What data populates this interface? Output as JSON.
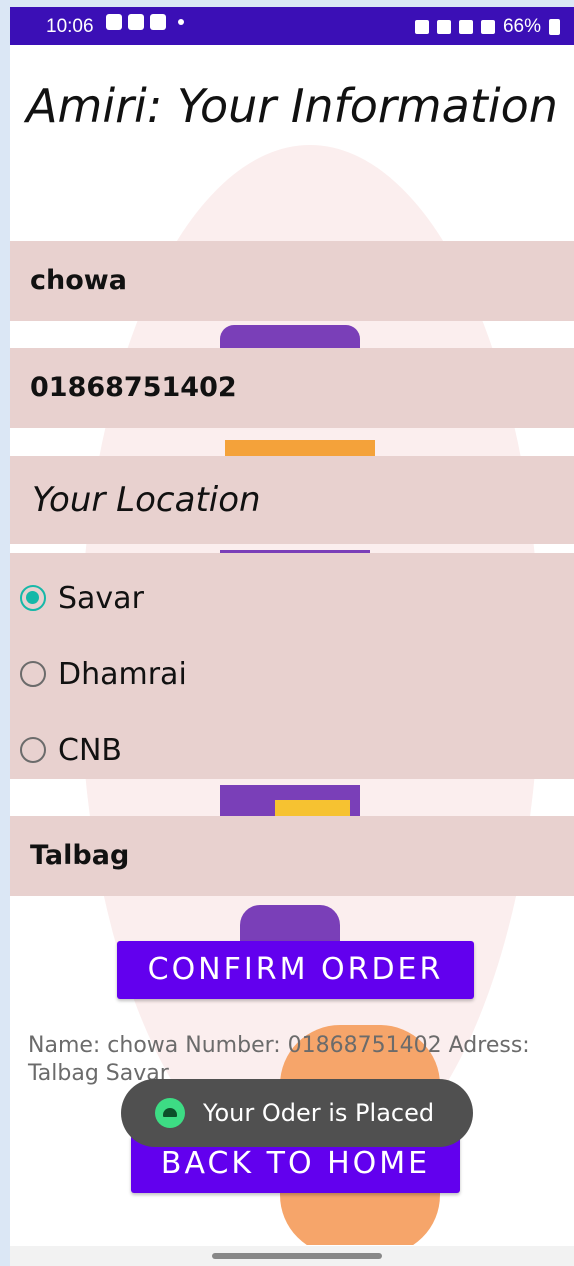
{
  "status_bar": {
    "time": "10:06",
    "battery": "66%",
    "icons": [
      "gallery-icon",
      "youtube-icon",
      "twitter-icon",
      "dot-icon",
      "alarm-icon",
      "mute-icon",
      "wifi-icon",
      "signal-icon",
      "battery-icon"
    ]
  },
  "title": "Amiri: Your Information",
  "form": {
    "name_value": "chowa",
    "phone_value": "01868751402",
    "location_heading": "Your Location",
    "locations": [
      {
        "label": "Savar",
        "checked": true
      },
      {
        "label": "Dhamrai",
        "checked": false
      },
      {
        "label": "CNB",
        "checked": false
      }
    ],
    "address_value": "Talbag"
  },
  "buttons": {
    "confirm": "CONFIRM ORDER",
    "back": "BACK TO HOME"
  },
  "summary": "Name: chowa Number: 01868751402 Adress: Talbag Savar",
  "toast": "Your Oder is Placed",
  "colors": {
    "status_bar": "#3b0fb6",
    "button": "#6200ee",
    "field_bg": "#e8d1cf",
    "radio_checked": "#16b8a8"
  }
}
